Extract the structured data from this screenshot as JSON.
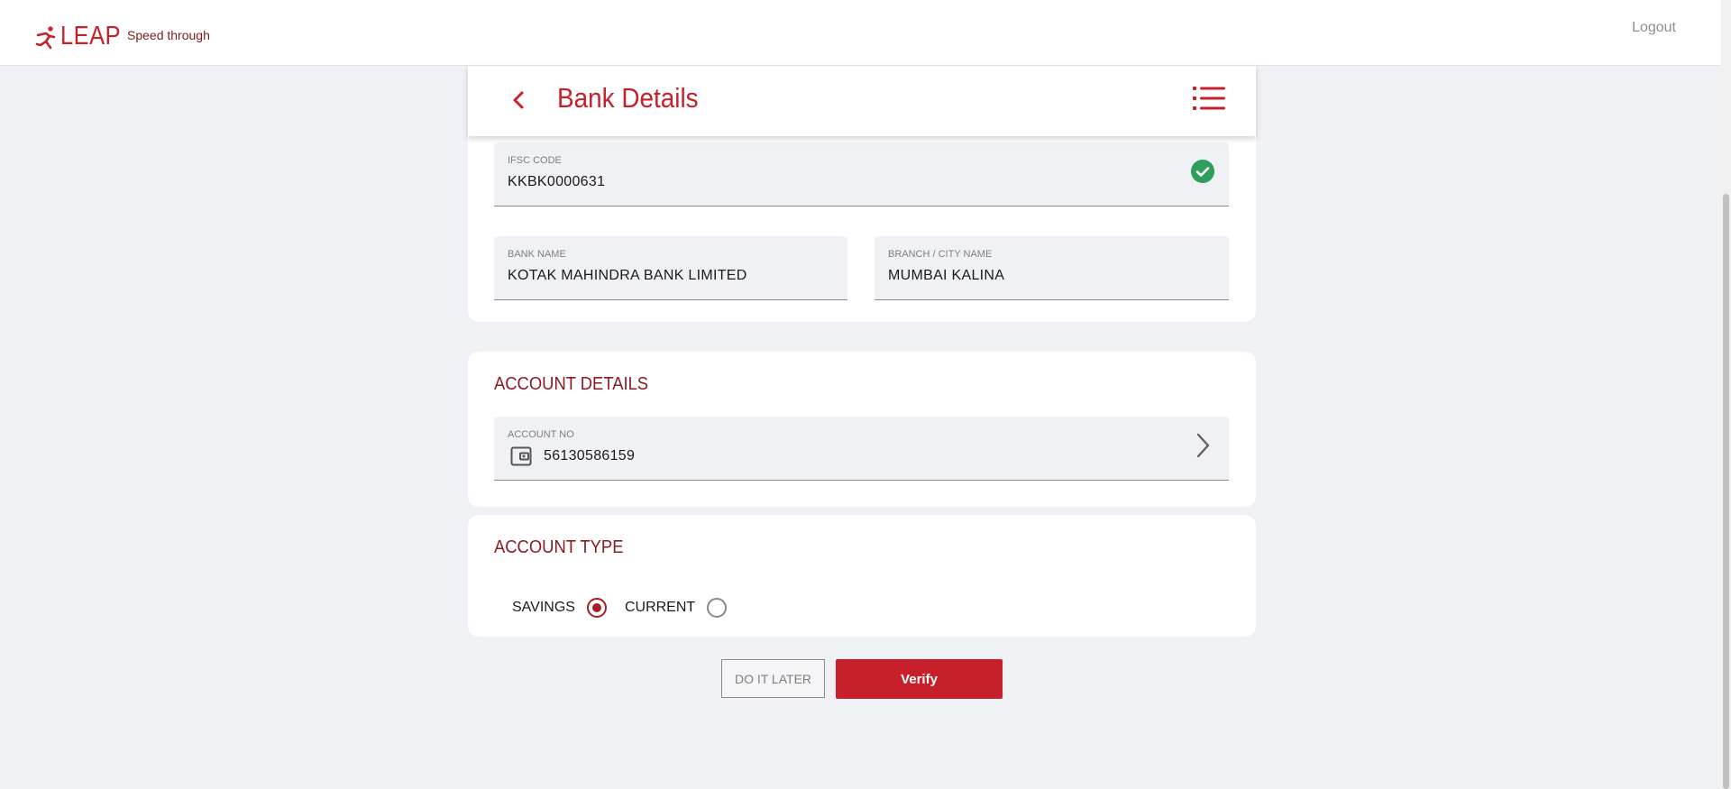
{
  "header": {
    "logo_text": "LEAP",
    "tagline": "Speed through",
    "logout_label": "Logout"
  },
  "page": {
    "title": "Bank Details"
  },
  "bank": {
    "ifsc": {
      "label": "IFSC CODE",
      "value": "KKBK0000631",
      "status_icon": "check-circle-icon"
    },
    "bank_name": {
      "label": "BANK NAME",
      "value": "KOTAK MAHINDRA BANK LIMITED"
    },
    "branch": {
      "label": "BRANCH / CITY NAME",
      "value": "MUMBAI KALINA"
    }
  },
  "account_details": {
    "title": "ACCOUNT DETAILS",
    "account_no": {
      "label": "ACCOUNT NO",
      "value": "56130586159",
      "icon": "wallet-icon"
    }
  },
  "account_type": {
    "title": "ACCOUNT TYPE",
    "options": [
      {
        "label": "SAVINGS",
        "selected": true
      },
      {
        "label": "CURRENT",
        "selected": false
      }
    ]
  },
  "actions": {
    "later_label": "DO IT LATER",
    "verify_label": "Verify"
  },
  "colors": {
    "brand_red": "#c8202b",
    "dark_red": "#8b1a1f",
    "success_green": "#2e9e5b",
    "background": "#f0f1f5"
  }
}
